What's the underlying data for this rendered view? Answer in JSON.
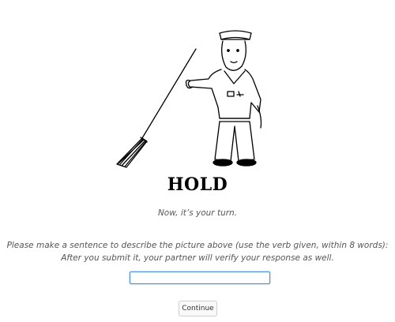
{
  "task": {
    "verb": "HOLD",
    "turn_text": "Now, it’s your turn.",
    "instruction_line1": "Please make a sentence to describe the picture above (use the verb given, within 8 words):",
    "instruction_line2": "After you submit it, your partner will verify your response as well.",
    "response_value": "",
    "continue_label": "Continue"
  },
  "illustration": {
    "icon": "sailor-holding-broom-icon"
  }
}
